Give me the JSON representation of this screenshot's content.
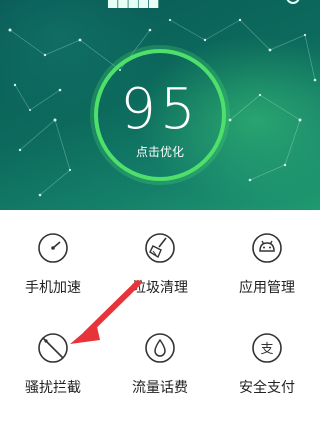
{
  "header": {
    "partial_title": "█████"
  },
  "score": {
    "value": "95",
    "action_label": "点击优化"
  },
  "features": [
    {
      "label": "手机加速",
      "icon": "speed-gauge-icon"
    },
    {
      "label": "垃圾清理",
      "icon": "broom-icon"
    },
    {
      "label": "应用管理",
      "icon": "android-robot-icon"
    },
    {
      "label": "骚扰拦截",
      "icon": "block-icon"
    },
    {
      "label": "流量话费",
      "icon": "water-drop-icon"
    },
    {
      "label": "安全支付",
      "icon": "pay-icon"
    }
  ],
  "pay_icon_glyph": "支",
  "colors": {
    "ring": "#4ee06a",
    "arrow": "#e8333a",
    "icon_stroke": "#333333"
  }
}
